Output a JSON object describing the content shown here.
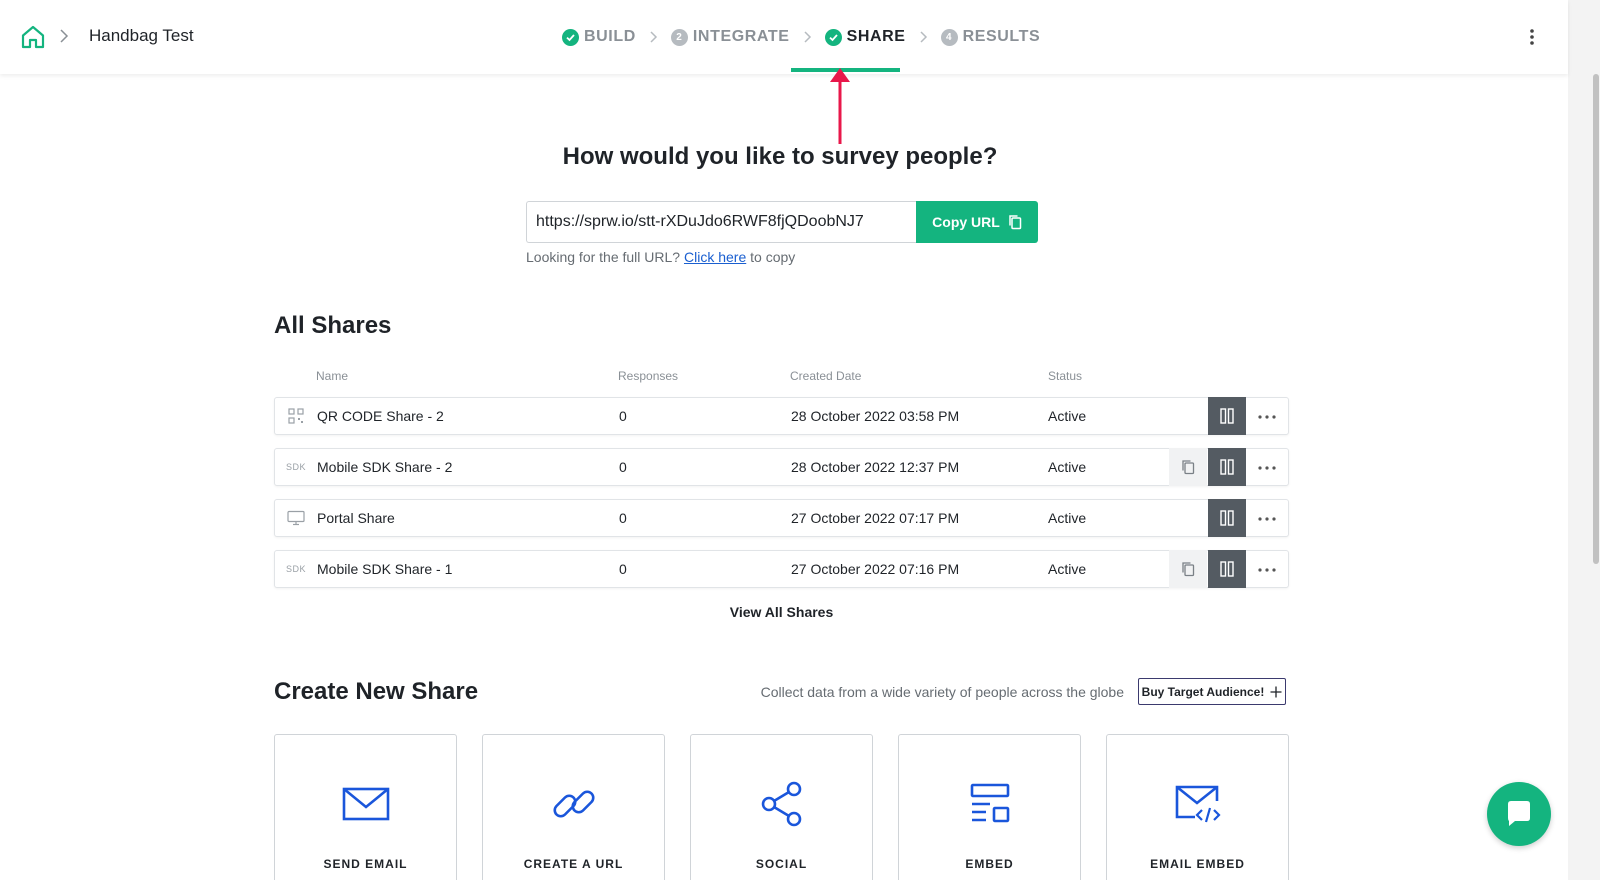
{
  "header": {
    "project_name": "Handbag Test",
    "steps": [
      {
        "label": "BUILD",
        "badge": "",
        "done": true
      },
      {
        "label": "INTEGRATE",
        "badge": "2",
        "done": false
      },
      {
        "label": "SHARE",
        "badge": "",
        "done": true
      },
      {
        "label": "RESULTS",
        "badge": "4",
        "done": false
      }
    ],
    "active_step": "SHARE"
  },
  "share_url": {
    "headline": "How would you like to survey people?",
    "value": "https://sprw.io/stt-rXDuJdo6RWF8fjQDoobNJ7",
    "copy_label": "Copy URL",
    "hint_prefix": "Looking for the full URL?",
    "hint_link": "Click here",
    "hint_suffix": "to copy"
  },
  "all_shares": {
    "title": "All Shares",
    "columns": [
      "Name",
      "Responses",
      "Created Date",
      "Status"
    ],
    "rows": [
      {
        "icon": "qr-code-icon",
        "name": "QR CODE Share - 2",
        "responses": "0",
        "created": "28 October 2022 03:58 PM",
        "status": "Active",
        "has_copy": false
      },
      {
        "icon": "sdk-icon",
        "icon_text": "SDK",
        "name": "Mobile SDK Share - 2",
        "responses": "0",
        "created": "28 October 2022 12:37 PM",
        "status": "Active",
        "has_copy": true
      },
      {
        "icon": "monitor-icon",
        "name": "Portal Share",
        "responses": "0",
        "created": "27 October 2022 07:17 PM",
        "status": "Active",
        "has_copy": false
      },
      {
        "icon": "sdk-icon",
        "icon_text": "SDK",
        "name": "Mobile SDK Share - 1",
        "responses": "0",
        "created": "27 October 2022 07:16 PM",
        "status": "Active",
        "has_copy": true
      }
    ],
    "view_all_label": "View All Shares"
  },
  "create_share": {
    "title": "Create New Share",
    "collect_text": "Collect data from a wide variety of people across the globe",
    "buy_label": "Buy Target Audience!",
    "cards": [
      {
        "icon": "email-icon",
        "label": "SEND EMAIL"
      },
      {
        "icon": "link-icon",
        "label": "CREATE A URL"
      },
      {
        "icon": "share-icon",
        "label": "SOCIAL"
      },
      {
        "icon": "embed-icon",
        "label": "EMBED"
      },
      {
        "icon": "email-embed-icon",
        "label": "EMAIL EMBED"
      }
    ]
  },
  "colors": {
    "accent": "#14b47f",
    "link": "#1a5fd0",
    "icon_blue": "#1a56db",
    "dark_action": "#545b62",
    "annotation_arrow": "#e8174a"
  }
}
